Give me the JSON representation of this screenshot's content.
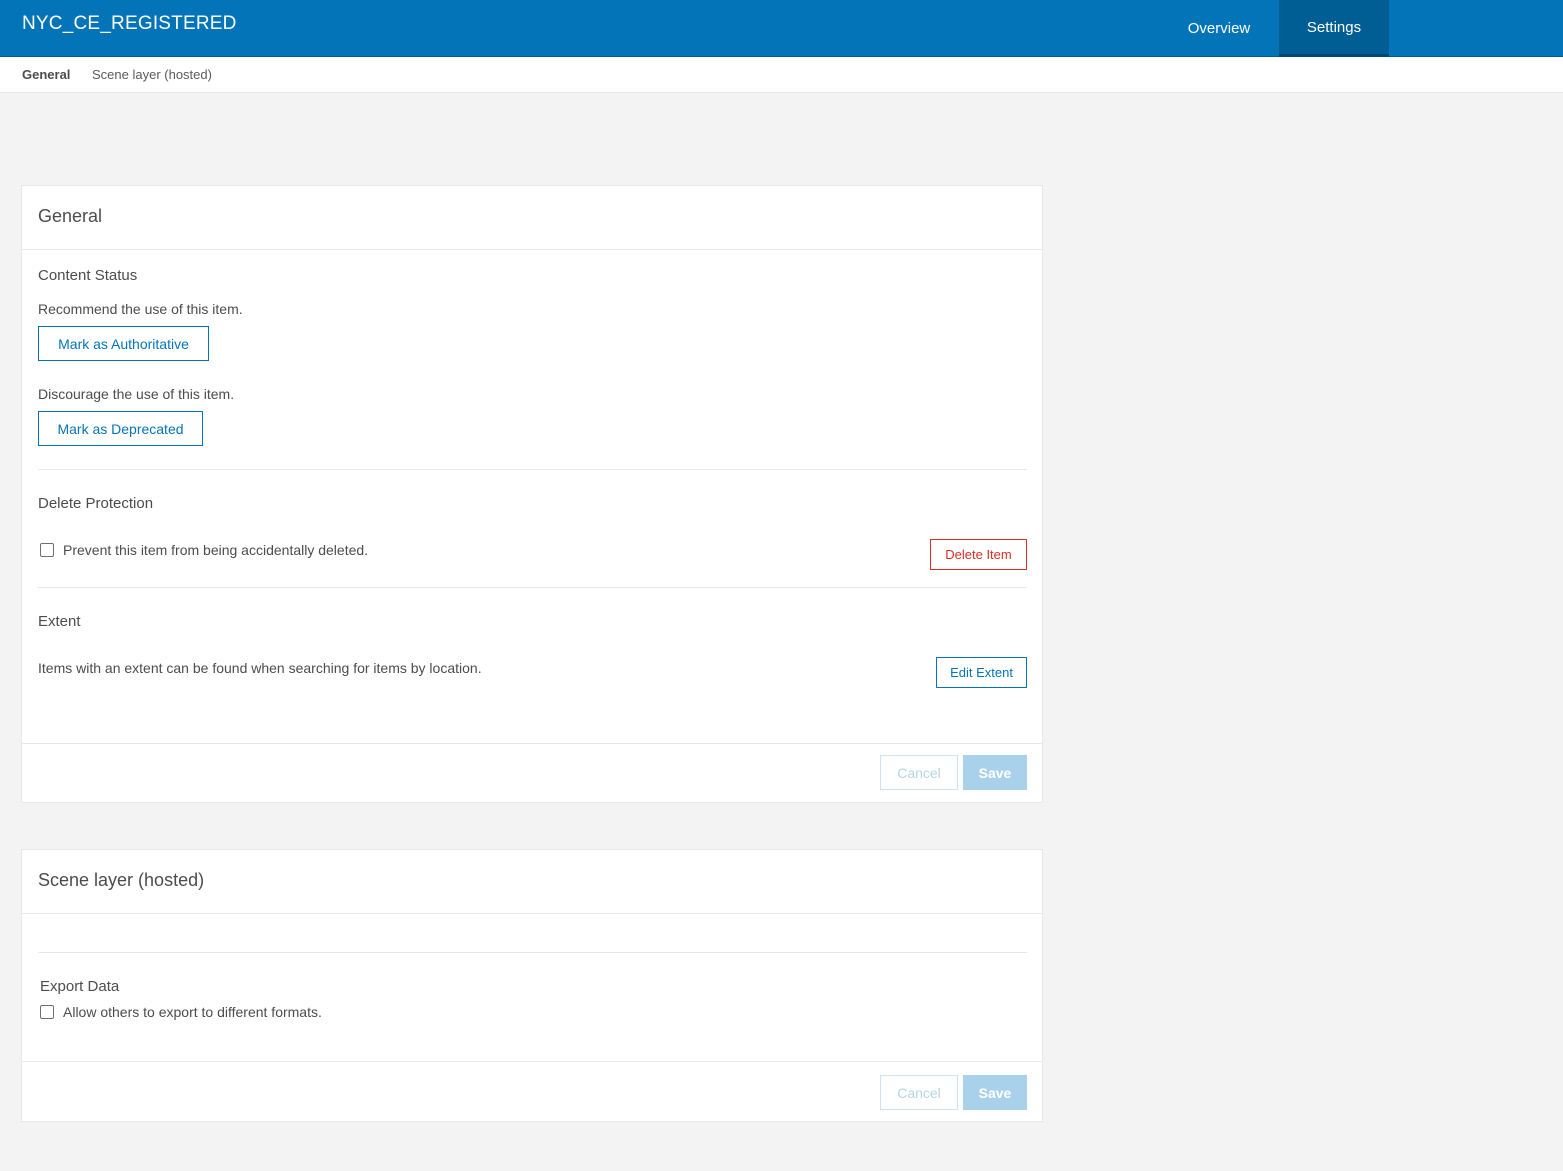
{
  "header": {
    "title": "NYC_CE_REGISTERED",
    "tabs": [
      {
        "label": "Overview",
        "active": false
      },
      {
        "label": "Settings",
        "active": true
      }
    ]
  },
  "subnav": {
    "items": [
      {
        "label": "General",
        "active": true
      },
      {
        "label": "Scene layer (hosted)",
        "active": false
      }
    ]
  },
  "general_card": {
    "title": "General",
    "content_status": {
      "title": "Content Status",
      "recommend_text": "Recommend the use of this item.",
      "authoritative_label": "Mark as Authoritative",
      "discourage_text": "Discourage the use of this item.",
      "deprecated_label": "Mark as Deprecated"
    },
    "delete_protection": {
      "title": "Delete Protection",
      "checkbox_label": "Prevent this item from being accidentally deleted.",
      "checked": false,
      "delete_label": "Delete Item"
    },
    "extent": {
      "title": "Extent",
      "description": "Items with an extent can be found when searching for items by location.",
      "edit_label": "Edit Extent"
    },
    "footer": {
      "cancel_label": "Cancel",
      "save_label": "Save"
    }
  },
  "scene_card": {
    "title": "Scene layer (hosted)",
    "export_data": {
      "title": "Export Data",
      "checkbox_label": "Allow others to export to different formats.",
      "checked": false
    },
    "footer": {
      "cancel_label": "Cancel",
      "save_label": "Save"
    }
  },
  "colors": {
    "brand_blue": "#0474b8",
    "active_tab": "#005e95",
    "danger_red": "#d83020",
    "disabled_save": "#a9d1ea"
  }
}
